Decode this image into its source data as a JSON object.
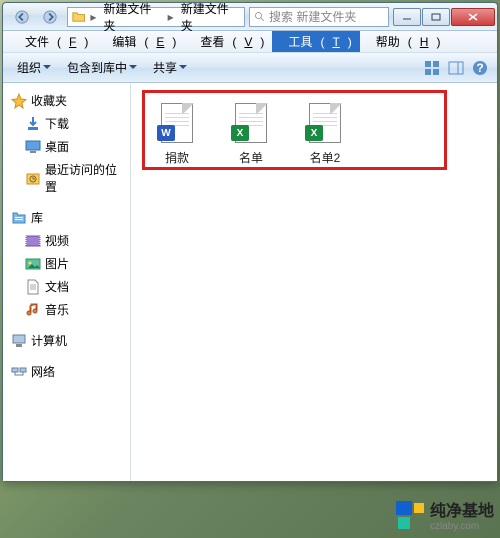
{
  "titlebar": {
    "breadcrumbs": [
      "新建文件夹",
      "新建文件夹"
    ],
    "search_placeholder": "搜索 新建文件夹"
  },
  "menubar": {
    "file": "文件",
    "file_hot": "F",
    "edit": "编辑",
    "edit_hot": "E",
    "view": "查看",
    "view_hot": "V",
    "tools": "工具",
    "tools_hot": "T",
    "help": "帮助",
    "help_hot": "H"
  },
  "toolbar": {
    "organize": "组织",
    "include": "包含到库中",
    "share": "共享"
  },
  "sidebar": {
    "groups": [
      {
        "icon": "star",
        "label": "收藏夹",
        "items": [
          {
            "icon": "download",
            "label": "下载"
          },
          {
            "icon": "desktop",
            "label": "桌面"
          },
          {
            "icon": "recent",
            "label": "最近访问的位置"
          }
        ]
      },
      {
        "icon": "library",
        "label": "库",
        "items": [
          {
            "icon": "video",
            "label": "视频"
          },
          {
            "icon": "picture",
            "label": "图片"
          },
          {
            "icon": "document",
            "label": "文档"
          },
          {
            "icon": "music",
            "label": "音乐"
          }
        ]
      },
      {
        "icon": "computer",
        "label": "计算机",
        "items": []
      },
      {
        "icon": "network",
        "label": "网络",
        "items": []
      }
    ]
  },
  "files": [
    {
      "name": "捐款",
      "type": "word",
      "badge": "W",
      "badge_color": "#2a5cc0"
    },
    {
      "name": "名单",
      "type": "excel",
      "badge": "X",
      "badge_color": "#1a8a40"
    },
    {
      "name": "名单2",
      "type": "excel",
      "badge": "X",
      "badge_color": "#1a8a40"
    }
  ],
  "watermark": {
    "title": "纯净基地",
    "url": "czlaby.com"
  }
}
